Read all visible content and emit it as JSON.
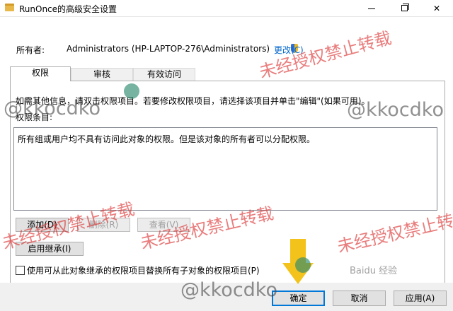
{
  "window": {
    "title": "RunOnce的高级安全设置",
    "minimize_icon": "minimize-icon",
    "maximize_icon": "restore-icon",
    "close_icon": "close-icon",
    "close_glyph": "✕"
  },
  "owner": {
    "label": "所有者:",
    "value": "Administrators (HP-LAPTOP-276\\Administrators)",
    "change_link": "更改(C)",
    "shield_icon": "uac-shield-icon"
  },
  "tabs": [
    {
      "label": "权限",
      "active": true
    },
    {
      "label": "审核",
      "active": false
    },
    {
      "label": "有效访问",
      "active": false
    }
  ],
  "permissions": {
    "info_text": "如需其他信息，请双击权限项目。若要修改权限项目，请选择该项目并单击\"编辑\"(如果可用)。",
    "entries_label": "权限条目:",
    "empty_message": "所有组或用户均不具有访问此对象的权限。但是该对象的所有者可以分配权限。",
    "add_button": "添加(D)",
    "remove_button": "删除(R)",
    "view_button": "查看(V)",
    "inherit_button": "启用继承(I)",
    "replace_checkbox_label": "使用可从此对象继承的权限项目替换所有子对象的权限项目(P)",
    "replace_checked": false
  },
  "footer": {
    "ok_button": "确定",
    "cancel_button": "取消",
    "apply_button": "应用(A)"
  },
  "overlays": {
    "watermark_red": "未经授权禁止转载",
    "watermark_handle": "@kkocdko",
    "baidu_logo": "Baidu 经验",
    "arrow_color": "#f3c21b",
    "dot_color": "#2e8b6e",
    "arrow_icon": "down-arrow-icon"
  },
  "colors": {
    "accent": "#0078d7",
    "link": "#0066cc",
    "watermark_red": "#dc2d2d"
  }
}
